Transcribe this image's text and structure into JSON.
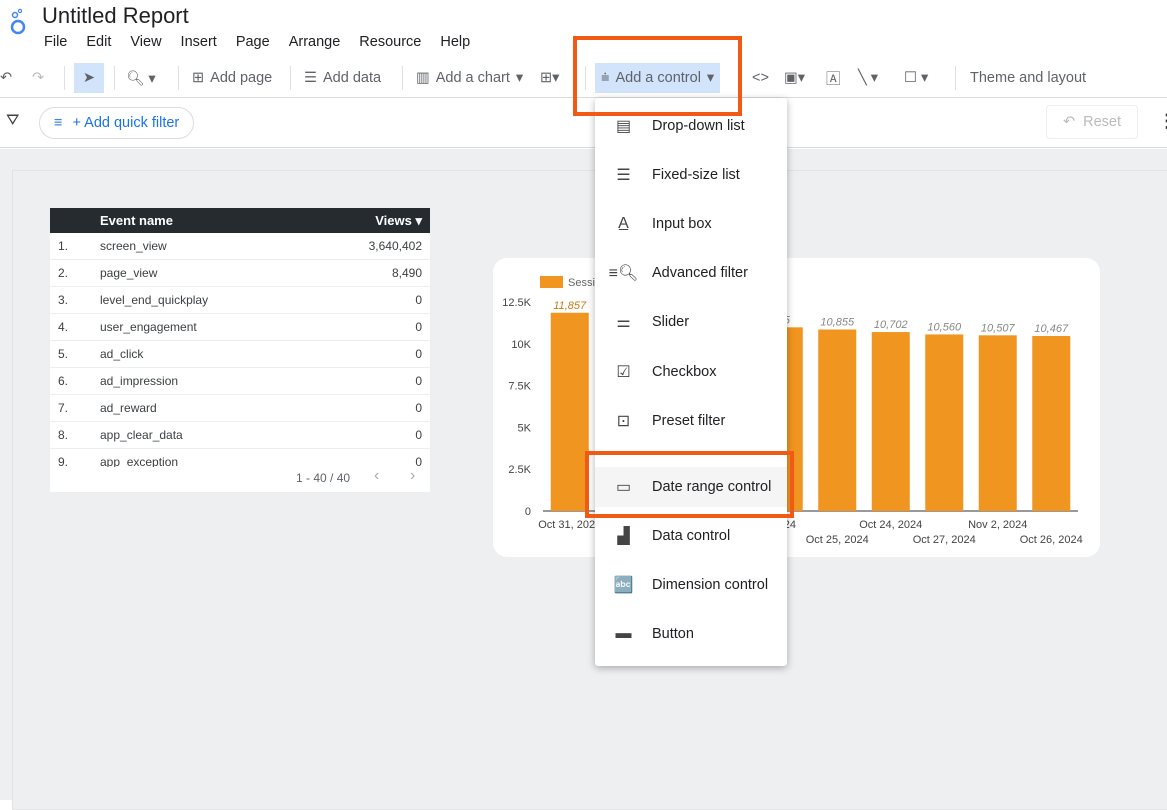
{
  "app": {
    "title": "Untitled Report",
    "logo_icon": "looker-studio-logo"
  },
  "menubar": [
    "File",
    "Edit",
    "View",
    "Insert",
    "Page",
    "Arrange",
    "Resource",
    "Help"
  ],
  "toolbar": {
    "add_page": "Add page",
    "add_data": "Add data",
    "add_chart": "Add a chart",
    "add_control": "Add a control",
    "theme": "Theme and layout"
  },
  "filterbar": {
    "quick_filter": "+ Add quick filter",
    "reset": "Reset"
  },
  "table": {
    "headers": [
      "Event name",
      "Views"
    ],
    "rows": [
      [
        "1.",
        "screen_view",
        "3,640,402"
      ],
      [
        "2.",
        "page_view",
        "8,490"
      ],
      [
        "3.",
        "level_end_quickplay",
        "0"
      ],
      [
        "4.",
        "user_engagement",
        "0"
      ],
      [
        "5.",
        "ad_click",
        "0"
      ],
      [
        "6.",
        "ad_impression",
        "0"
      ],
      [
        "7.",
        "ad_reward",
        "0"
      ],
      [
        "8.",
        "app_clear_data",
        "0"
      ],
      [
        "9.",
        "app_exception",
        "0"
      ]
    ],
    "pagination": "1 - 40 / 40"
  },
  "control_menu": {
    "items": [
      "Drop-down list",
      "Fixed-size list",
      "Input box",
      "Advanced filter",
      "Slider",
      "Checkbox",
      "Preset filter",
      "Date range control",
      "Data control",
      "Dimension control",
      "Button"
    ],
    "highlighted": "Date range control"
  },
  "colors": {
    "accent": "#f0951f",
    "highlight": "#f05a14",
    "brand": "#4285f4"
  },
  "chart_data": {
    "type": "bar",
    "legend": "Sessi",
    "ylim": [
      0,
      12500
    ],
    "yticks": [
      "0",
      "2.5K",
      "5K",
      "7.5K",
      "10K",
      "12.5K"
    ],
    "ytick_values": [
      0,
      2500,
      5000,
      7500,
      10000,
      12500
    ],
    "categories": [
      "Oct 31, 2024",
      "N",
      "",
      "",
      "2024",
      "Oct 25, 2024",
      "Oct 24, 2024",
      "Oct 27, 2024",
      "Nov 2, 2024",
      "Oct 26, 2024"
    ],
    "values": [
      11857,
      null,
      null,
      null,
      10985,
      10855,
      10702,
      10560,
      10507,
      10467
    ],
    "labels": [
      "11,857",
      "",
      "",
      "",
      "85",
      "10,855",
      "10,702",
      "10,560",
      "10,507",
      "10,467"
    ]
  }
}
